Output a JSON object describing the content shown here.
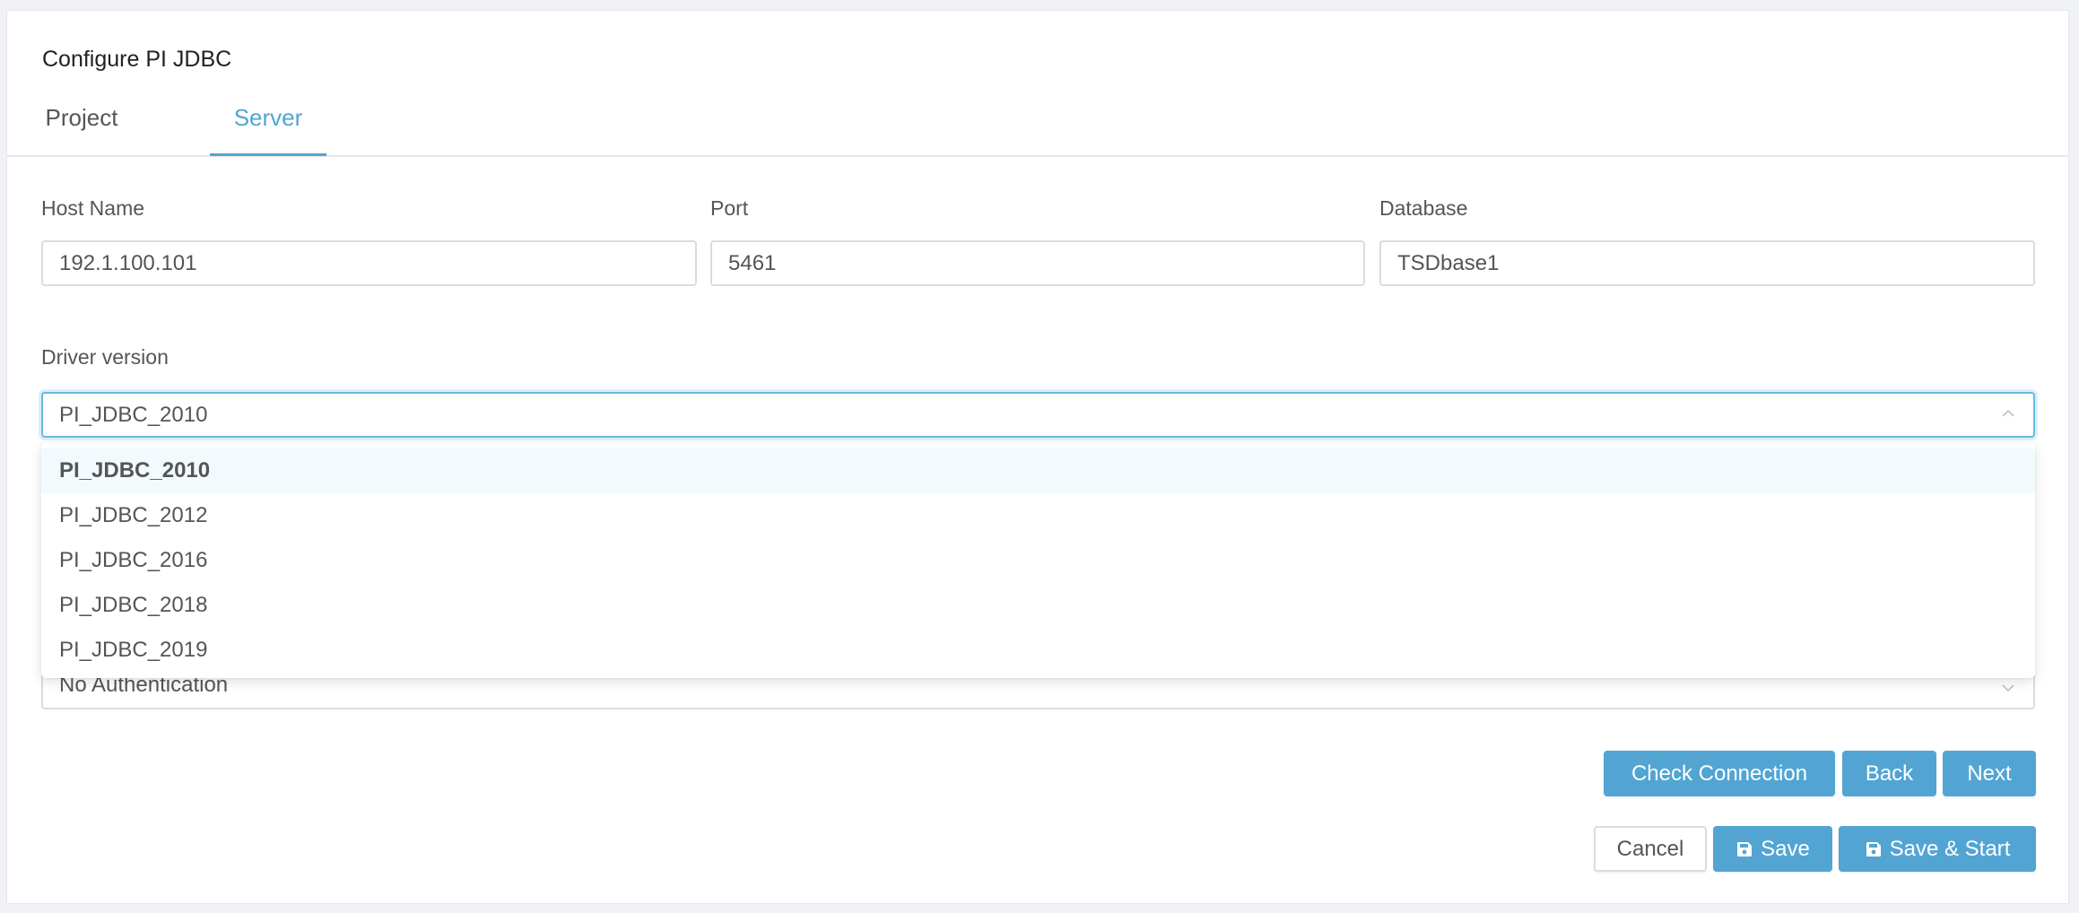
{
  "page": {
    "title": "Configure PI JDBC"
  },
  "tabs": [
    {
      "label": "Project",
      "active": false
    },
    {
      "label": "Server",
      "active": true
    }
  ],
  "form": {
    "host": {
      "label": "Host Name",
      "value": "192.1.100.101"
    },
    "port": {
      "label": "Port",
      "value": "5461"
    },
    "database": {
      "label": "Database",
      "value": "TSDbase1"
    },
    "driver": {
      "label": "Driver version",
      "value": "PI_JDBC_2010",
      "options": [
        "PI_JDBC_2010",
        "PI_JDBC_2012",
        "PI_JDBC_2016",
        "PI_JDBC_2018",
        "PI_JDBC_2019"
      ],
      "selected_index": 0,
      "open": true
    },
    "authentication": {
      "value": "No Authentication"
    }
  },
  "actions": {
    "check_connection": "Check Connection",
    "back": "Back",
    "next": "Next",
    "cancel": "Cancel",
    "save": "Save",
    "save_start": "Save & Start"
  },
  "colors": {
    "accent": "#52a5d3",
    "background": "#f0f2f5",
    "option_highlight": "#f2fafe"
  },
  "icons": {
    "save": "floppy-disk-icon",
    "dropdown_open": "chevron-up-icon",
    "dropdown_closed": "chevron-down-icon"
  }
}
